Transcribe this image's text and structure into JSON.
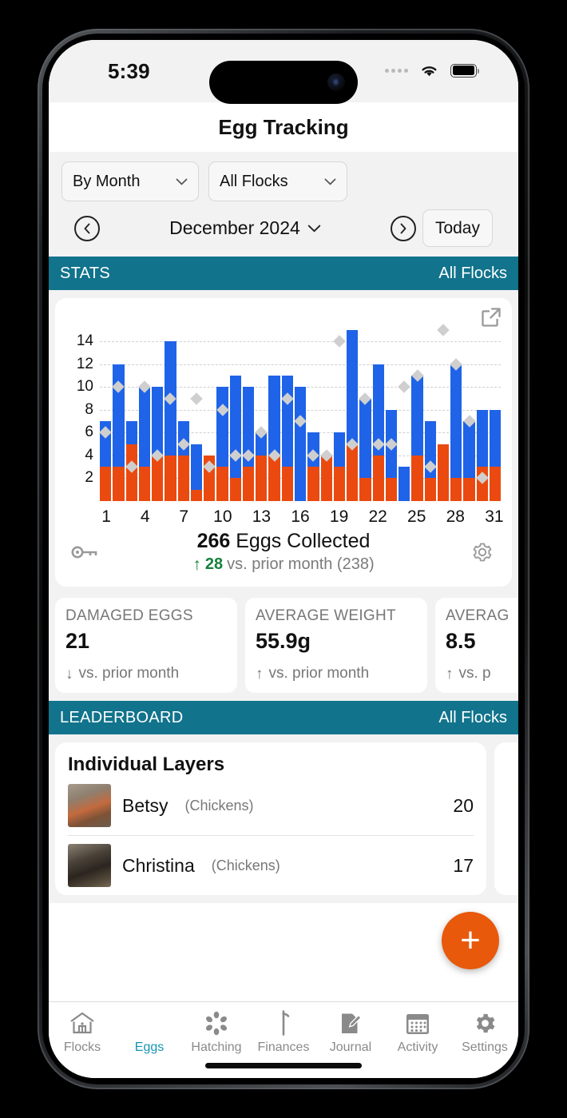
{
  "status_bar": {
    "time": "5:39",
    "wifi_icon": "wifi-icon",
    "battery_icon": "battery-icon"
  },
  "navbar": {
    "title": "Egg Tracking"
  },
  "filters": {
    "period": {
      "label": "By Month",
      "chevron": "chevron-down-icon"
    },
    "flock": {
      "label": "All Flocks",
      "chevron": "chevron-down-icon"
    }
  },
  "date_nav": {
    "prev_icon": "chevron-left-circle-icon",
    "next_icon": "chevron-right-circle-icon",
    "current": "December 2024",
    "dropdown_icon": "chevron-down-icon",
    "today_label": "Today"
  },
  "stats_section": {
    "title": "STATS",
    "action": "All Flocks"
  },
  "chart_card": {
    "expand_icon": "external-link-icon",
    "key_icon": "key-icon",
    "gear_icon": "gear-icon",
    "total": "266",
    "total_label": "Eggs Collected",
    "delta_arrow": "arrow-up-icon",
    "delta_value": "28",
    "delta_text": "vs. prior month (238)"
  },
  "chart_data": {
    "type": "bar",
    "title": "Eggs Collected",
    "xlabel": "",
    "ylabel": "",
    "grid": true,
    "ylim": [
      0,
      15
    ],
    "yticks": [
      2,
      4,
      6,
      8,
      10,
      12,
      14
    ],
    "categories": [
      1,
      2,
      3,
      4,
      5,
      6,
      7,
      8,
      9,
      10,
      11,
      12,
      13,
      14,
      15,
      16,
      17,
      18,
      19,
      20,
      21,
      22,
      23,
      24,
      25,
      26,
      27,
      28,
      29,
      30,
      31
    ],
    "xtick_labels": [
      "1",
      "4",
      "7",
      "10",
      "13",
      "16",
      "19",
      "22",
      "25",
      "28",
      "31"
    ],
    "xtick_positions": [
      1,
      4,
      7,
      10,
      13,
      16,
      19,
      22,
      25,
      28,
      31
    ],
    "series": [
      {
        "name": "collected-orange",
        "color": "#ea4a10",
        "values": [
          3,
          3,
          5,
          3,
          4,
          4,
          4,
          1,
          4,
          3,
          2,
          3,
          4,
          4,
          3,
          0,
          3,
          4,
          3,
          5,
          2,
          4,
          2,
          0,
          4,
          2,
          5,
          2,
          2,
          3,
          3
        ]
      },
      {
        "name": "collected-blue",
        "color": "#1f63e8",
        "values": [
          4,
          9,
          2,
          7,
          6,
          10,
          3,
          4,
          0,
          7,
          9,
          7,
          2,
          7,
          8,
          10,
          3,
          0,
          3,
          10,
          7,
          8,
          6,
          3,
          7,
          5,
          0,
          10,
          5,
          5,
          5
        ]
      }
    ],
    "totals": [
      7,
      12,
      7,
      10,
      10,
      14,
      7,
      5,
      4,
      10,
      11,
      10,
      6,
      11,
      11,
      10,
      6,
      4,
      6,
      15,
      9,
      12,
      8,
      3,
      11,
      7,
      5,
      12,
      7,
      8,
      8
    ],
    "marker_series": {
      "name": "prior-period",
      "color": "#cfcfcf",
      "shape": "diamond",
      "values": [
        6,
        10,
        3,
        10,
        4,
        9,
        5,
        9,
        3,
        8,
        4,
        4,
        6,
        4,
        9,
        7,
        4,
        4,
        14,
        5,
        9,
        5,
        5,
        10,
        11,
        3,
        15,
        12,
        7,
        2,
        null
      ]
    }
  },
  "stat_cards": [
    {
      "title": "DAMAGED EGGS",
      "value": "21",
      "arrow": "arrow-down-icon",
      "arrow_dir": "down",
      "foot": "vs. prior month"
    },
    {
      "title": "AVERAGE WEIGHT",
      "value": "55.9g",
      "arrow": "arrow-up-icon",
      "arrow_dir": "up",
      "foot": "vs. prior month"
    },
    {
      "title": "AVERAG",
      "value": "8.5",
      "arrow": "arrow-up-icon",
      "arrow_dir": "up",
      "foot": "vs. p"
    }
  ],
  "leaderboard_section": {
    "title": "LEADERBOARD",
    "action": "All Flocks"
  },
  "leaderboard": {
    "card_title": "Individual Layers",
    "rows": [
      {
        "name": "Betsy",
        "species": "(Chickens)",
        "count": "20"
      },
      {
        "name": "Christina",
        "species": "(Chickens)",
        "count": "17"
      }
    ]
  },
  "fab": {
    "icon": "plus-icon"
  },
  "tabbar": {
    "items": [
      {
        "label": "Flocks",
        "icon": "coop-house-icon",
        "active": false
      },
      {
        "label": "Eggs",
        "icon": "egg-icon",
        "active": true
      },
      {
        "label": "Hatching",
        "icon": "hatching-icon",
        "active": false
      },
      {
        "label": "Finances",
        "icon": "dollar-icon",
        "active": false
      },
      {
        "label": "Journal",
        "icon": "journal-pencil-icon",
        "active": false
      },
      {
        "label": "Activity",
        "icon": "calendar-icon",
        "active": false
      },
      {
        "label": "Settings",
        "icon": "gear-icon",
        "active": false
      }
    ]
  },
  "colors": {
    "accent_teal": "#11738c",
    "bar_blue": "#1f63e8",
    "bar_orange": "#ea4a10",
    "fab_orange": "#e8590c",
    "active_tab": "#1594b4"
  }
}
